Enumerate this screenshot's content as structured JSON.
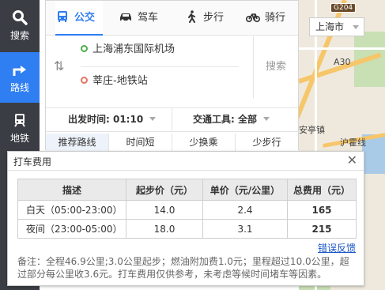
{
  "leftbar": {
    "items": [
      {
        "label": "搜索",
        "icon": "search-icon"
      },
      {
        "label": "路线",
        "icon": "route-icon",
        "active": true
      },
      {
        "label": "地铁",
        "icon": "subway-icon"
      }
    ]
  },
  "modes": [
    {
      "label": "公交",
      "icon": "bus-icon",
      "active": true
    },
    {
      "label": "驾车",
      "icon": "car-icon"
    },
    {
      "label": "步行",
      "icon": "walk-icon"
    },
    {
      "label": "骑行",
      "icon": "bike-icon"
    }
  ],
  "route": {
    "start": "上海浦东国际机场",
    "end": "莘庄-地铁站",
    "search_label": "搜索"
  },
  "options": {
    "depart_label": "出发时间: 01:10",
    "transport_label": "交通工具: 全部"
  },
  "tabs": [
    "推荐路线",
    "时间短",
    "少换乘",
    "少步行"
  ],
  "map": {
    "city": "上海市",
    "road_sign": "G204",
    "a30": "A30",
    "town1": "安亭镇",
    "road_label": "沪霍线"
  },
  "popup": {
    "title": "打车费用",
    "headers": [
      "描述",
      "起步价（元）",
      "单价（元/公里）",
      "总费用（元）"
    ],
    "rows": [
      [
        "白天（05:00-23:00）",
        "14.0",
        "2.4",
        "165"
      ],
      [
        "夜间（23:00-05:00）",
        "18.0",
        "3.1",
        "215"
      ]
    ],
    "feedback": "错误反馈",
    "note": "备注：全程46.9公里;3.0公里起步；燃油附加费1.0元；里程超过10.0公里，超过部分每公里收3.6元。打车费用仅供参考，未考虑等候时间堵车等因素。"
  },
  "colors": {
    "accent": "#2f7ef2",
    "sidebar": "#3a3e44",
    "link": "#1a56c8"
  }
}
